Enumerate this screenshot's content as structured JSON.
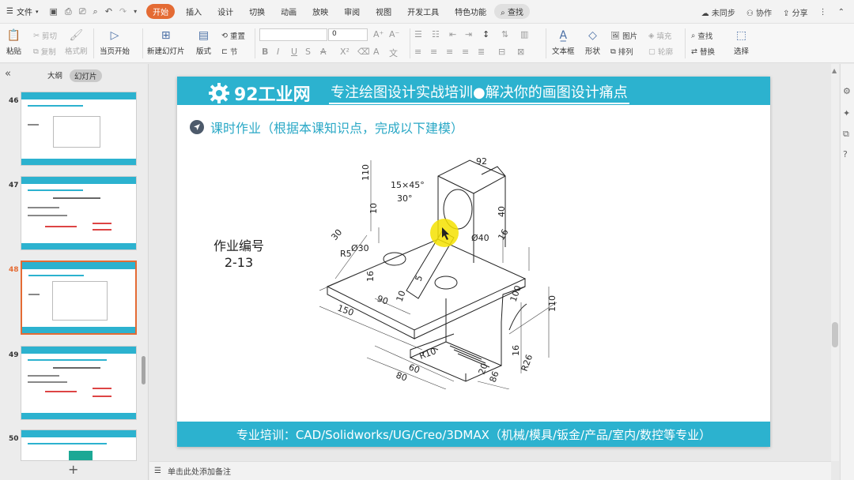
{
  "menubar": {
    "file_label": "文件",
    "tabs": [
      "开始",
      "插入",
      "设计",
      "切换",
      "动画",
      "放映",
      "审阅",
      "视图",
      "开发工具",
      "特色功能"
    ],
    "search_label": "查找",
    "sync_label": "未同步",
    "collab_label": "协作",
    "share_label": "分享"
  },
  "ribbon": {
    "paste": "粘贴",
    "cut": "剪切",
    "copy": "复制",
    "format_painter": "格式刷",
    "from_current": "当页开始",
    "new_slide": "新建幻灯片",
    "layout": "版式",
    "section": "节",
    "reset": "重置",
    "font_size": "0",
    "textbox": "文本框",
    "shape": "形状",
    "arrange": "排列",
    "picture": "图片",
    "fill": "填充",
    "outline": "轮廓",
    "find": "查找",
    "replace": "替换",
    "select": "选择"
  },
  "left_panel": {
    "outline_tab": "大纲",
    "slides_tab": "幻灯片",
    "slide_numbers": [
      "46",
      "47",
      "48",
      "49",
      "50"
    ],
    "active_slide": "48"
  },
  "slide": {
    "logo_text": "92工业网",
    "slogan": "专注绘图设计实战培训●解决你的画图设计痛点",
    "task": "课时作业（根据本课知识点，完成以下建模）",
    "job_label": "作业编号",
    "job_number": "2-13",
    "footer": "专业培训：CAD/Solidworks/UG/Creo/3DMAX（机械/模具/钣金/产品/室内/数控等专业）",
    "dims": [
      "92",
      "110",
      "15×45°",
      "10",
      "30°",
      "40",
      "16",
      "Ø40",
      "30",
      "Ø30",
      "R5",
      "16",
      "5",
      "10",
      "90",
      "150",
      "100",
      "110",
      "16",
      "R10",
      "60",
      "80",
      "R26",
      "20",
      "86"
    ]
  },
  "notes": {
    "placeholder": "单击此处添加备注"
  },
  "colors": {
    "accent_orange": "#e46b34",
    "slide_cyan": "#2cb2cf",
    "highlight_yellow": "#f5e200"
  }
}
